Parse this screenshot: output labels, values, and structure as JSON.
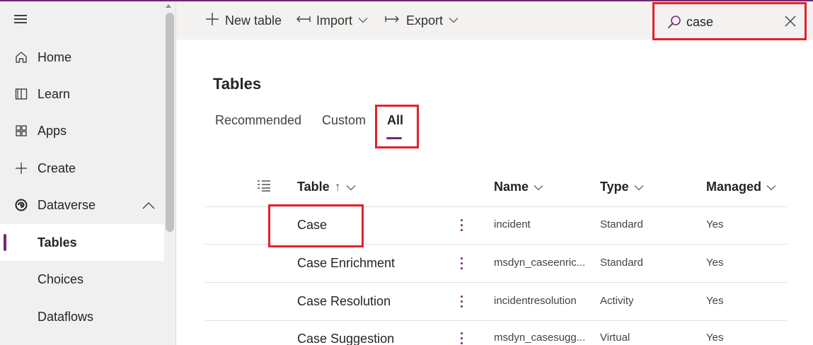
{
  "brand_color": "#742774",
  "highlight_color": "#e3212b",
  "sidebar": {
    "menu_icon": "hamburger-icon",
    "items": [
      {
        "label": "Home",
        "icon": "home-icon"
      },
      {
        "label": "Learn",
        "icon": "book-icon"
      },
      {
        "label": "Apps",
        "icon": "apps-icon"
      },
      {
        "label": "Create",
        "icon": "plus-icon"
      },
      {
        "label": "Dataverse",
        "icon": "dataverse-icon",
        "expanded": true
      },
      {
        "label": "Tables",
        "active": true
      },
      {
        "label": "Choices"
      },
      {
        "label": "Dataflows"
      }
    ]
  },
  "commandbar": {
    "new_table": "New table",
    "import": "Import",
    "export": "Export"
  },
  "search": {
    "value": "case"
  },
  "main": {
    "title": "Tables",
    "tabs": [
      {
        "label": "Recommended"
      },
      {
        "label": "Custom"
      },
      {
        "label": "All",
        "selected": true
      }
    ],
    "columns": {
      "table": "Table",
      "table_sort": "↑",
      "name": "Name",
      "type": "Type",
      "managed": "Managed"
    },
    "rows": [
      {
        "table": "Case",
        "name": "incident",
        "type": "Standard",
        "managed": "Yes"
      },
      {
        "table": "Case Enrichment",
        "name": "msdyn_caseenric...",
        "type": "Standard",
        "managed": "Yes"
      },
      {
        "table": "Case Resolution",
        "name": "incidentresolution",
        "type": "Activity",
        "managed": "Yes"
      },
      {
        "table": "Case Suggestion",
        "name": "msdyn_casesugg...",
        "type": "Virtual",
        "managed": "Yes"
      }
    ]
  }
}
